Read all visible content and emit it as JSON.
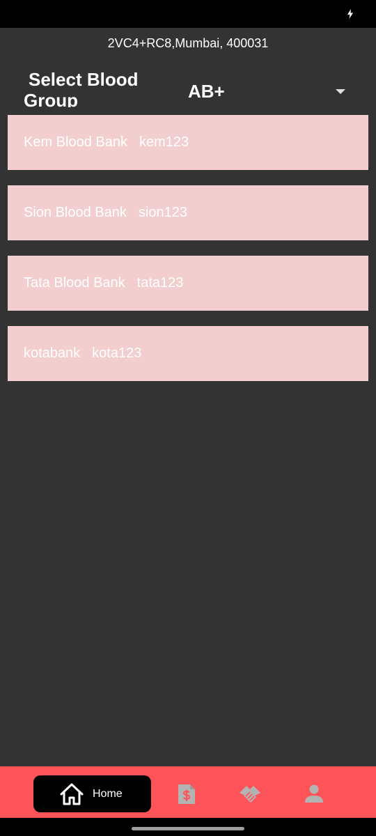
{
  "location": "2VC4+RC8,Mumbai, 400031",
  "selector": {
    "label_line1": "Select Blood",
    "label_line2": "Group",
    "value": "AB+"
  },
  "banks": [
    {
      "name": "Kem Blood Bank",
      "code": "kem123"
    },
    {
      "name": "Sion Blood Bank",
      "code": "sion123"
    },
    {
      "name": "Tata Blood Bank",
      "code": "tata123"
    },
    {
      "name": "kotabank",
      "code": "kota123"
    }
  ],
  "nav": {
    "home_label": "Home",
    "icons": [
      "home-icon",
      "invoice-icon",
      "handshake-icon",
      "person-icon"
    ]
  },
  "colors": {
    "background": "#333333",
    "card": "#f2cfce",
    "nav_bar": "#fe5358",
    "nav_active": "#000000"
  }
}
